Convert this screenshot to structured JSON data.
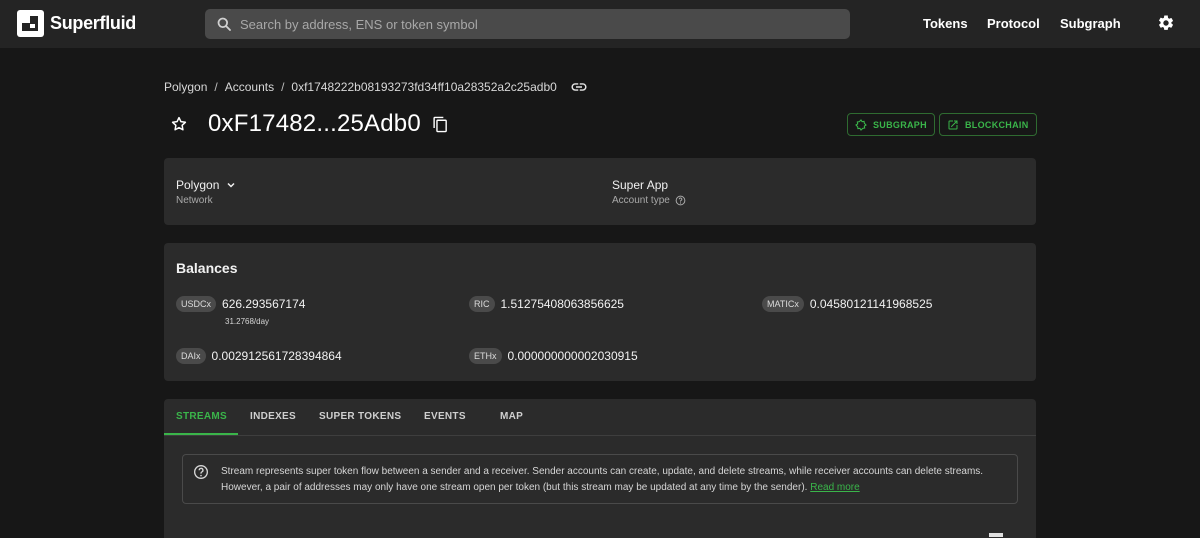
{
  "app": {
    "name": "Superfluid"
  },
  "search": {
    "placeholder": "Search by address, ENS or token symbol"
  },
  "nav": {
    "tokens": "Tokens",
    "protocol": "Protocol",
    "subgraph": "Subgraph"
  },
  "breadcrumb": {
    "network": "Polygon",
    "section": "Accounts",
    "address": "0xf1748222b08193273fd34ff10a28352a2c25adb0",
    "separator": "/"
  },
  "account": {
    "title": "0xF17482...25Adb0",
    "subgraph_label": "SUBGRAPH",
    "blockchain_label": "BLOCKCHAIN"
  },
  "info": {
    "network_value": "Polygon",
    "network_label": "Network",
    "account_type_value": "Super App",
    "account_type_label": "Account type"
  },
  "balances": {
    "title": "Balances",
    "items": [
      {
        "symbol": "USDCx",
        "value": "626.293567174",
        "rate": "31.2768/day"
      },
      {
        "symbol": "RIC",
        "value": "1.51275408063856625"
      },
      {
        "symbol": "MATICx",
        "value": "0.04580121141968525"
      },
      {
        "symbol": "DAIx",
        "value": "0.002912561728394864"
      },
      {
        "symbol": "ETHx",
        "value": "0.000000000002030915"
      }
    ]
  },
  "tabs": [
    "STREAMS",
    "INDEXES",
    "SUPER TOKENS",
    "EVENTS",
    "MAP"
  ],
  "streams_info": {
    "text": "Stream represents super token flow between a sender and a receiver. Sender accounts can create, update, and delete streams, while receiver accounts can delete streams. However, a pair of addresses may only have one stream open per token (but this stream may be updated at any time by the sender).",
    "link": "Read more"
  },
  "colors": {
    "accent": "#3ab54a",
    "background": "#171717",
    "card": "#2b2b2b",
    "topbar": "#242424"
  }
}
